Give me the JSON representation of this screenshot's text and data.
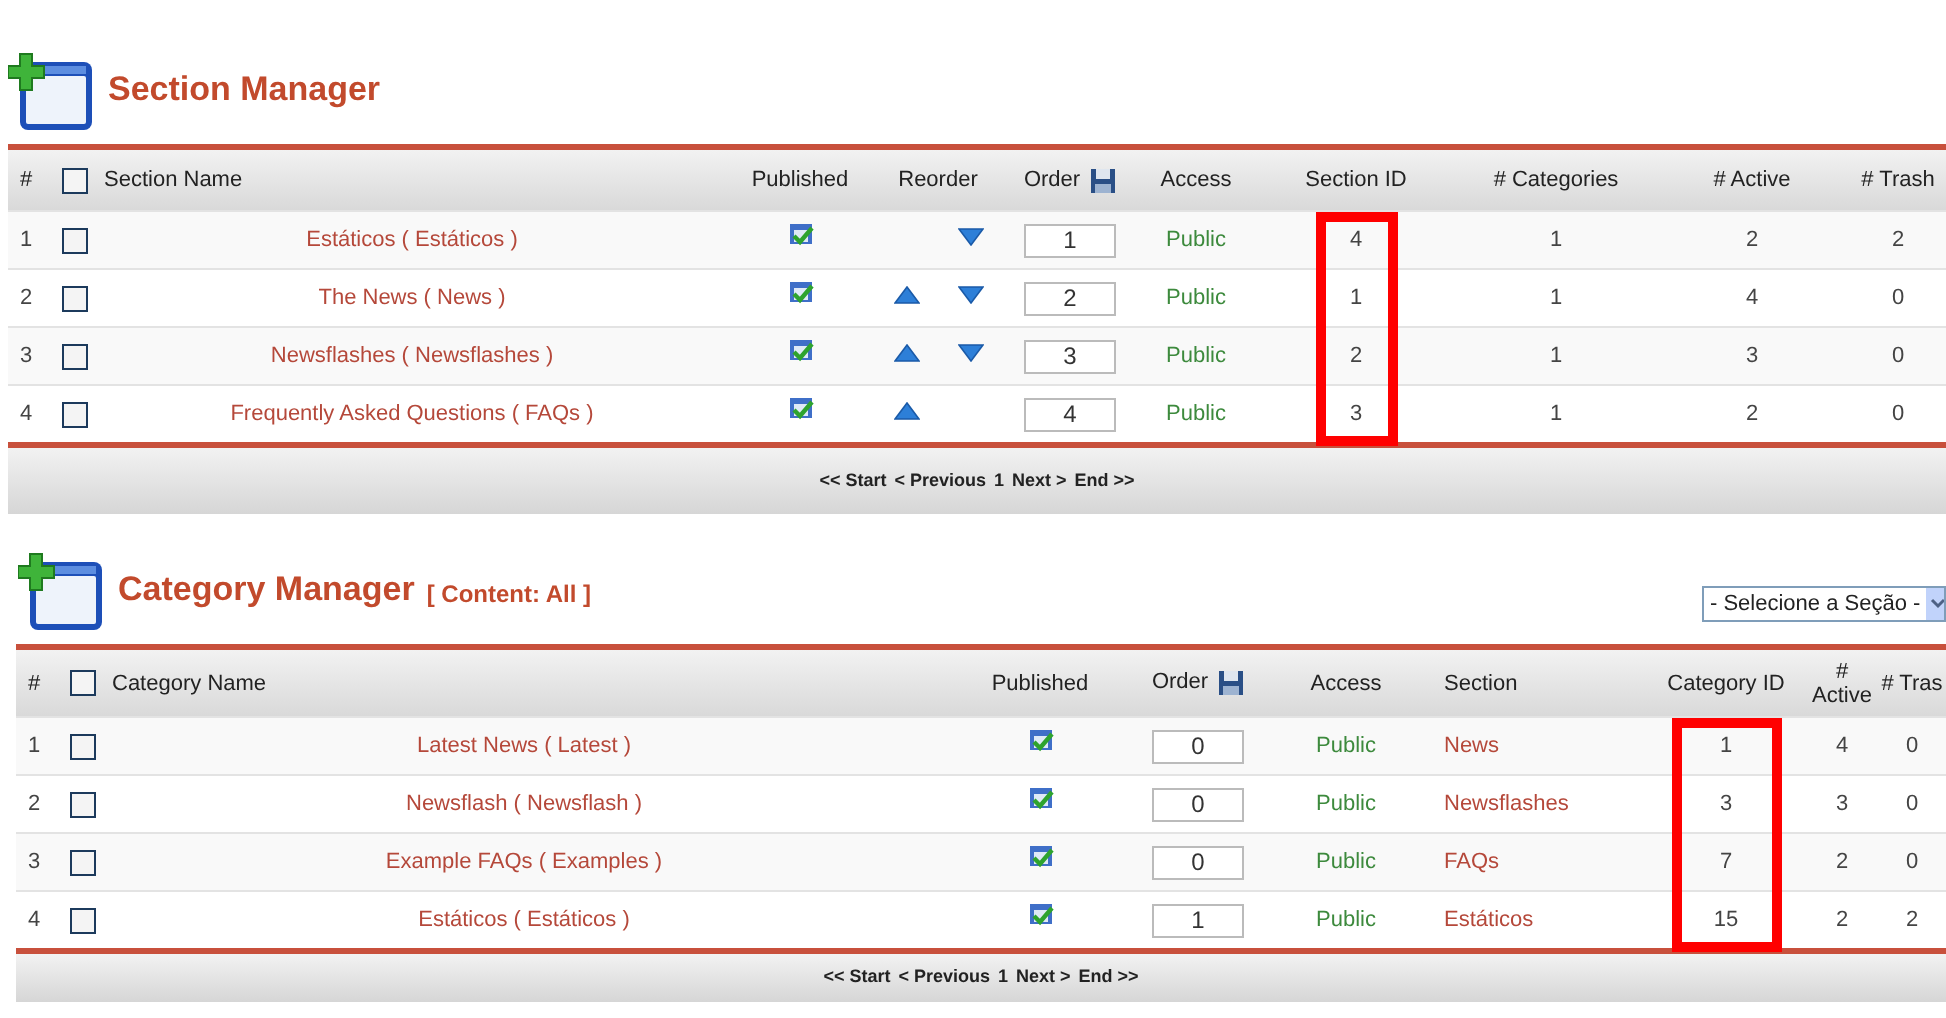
{
  "section_manager": {
    "title": "Section Manager",
    "table": {
      "columns": [
        {
          "kind": "number",
          "label": "#"
        },
        {
          "kind": "checkbox",
          "checked": false
        },
        {
          "kind": "name",
          "label": "Section Name"
        },
        {
          "kind": "published",
          "label": "Published"
        },
        {
          "kind": "reorder",
          "label": "Reorder"
        },
        {
          "kind": "order",
          "label": "Order"
        },
        {
          "kind": "access",
          "label": "Access"
        },
        {
          "kind": "text",
          "label": "Section ID",
          "highlighted": true
        },
        {
          "kind": "text",
          "label": "# Categories"
        },
        {
          "kind": "text",
          "label": "# Active"
        },
        {
          "kind": "text",
          "label": "# Trash"
        }
      ],
      "rows": [
        {
          "cells": [
            "1",
            {
              "checked": false
            },
            "Estáticos ( Estáticos )",
            {
              "published": true
            },
            {
              "up": false,
              "down": true
            },
            "1",
            "Public",
            "4",
            "1",
            "2",
            "2"
          ]
        },
        {
          "cells": [
            "2",
            {
              "checked": false
            },
            "The News ( News )",
            {
              "published": true
            },
            {
              "up": true,
              "down": true
            },
            "2",
            "Public",
            "1",
            "1",
            "4",
            "0"
          ]
        },
        {
          "cells": [
            "3",
            {
              "checked": false
            },
            "Newsflashes ( Newsflashes )",
            {
              "published": true
            },
            {
              "up": true,
              "down": true
            },
            "3",
            "Public",
            "2",
            "1",
            "3",
            "0"
          ]
        },
        {
          "cells": [
            "4",
            {
              "checked": false
            },
            "Frequently Asked Questions ( FAQs )",
            {
              "published": true
            },
            {
              "up": true,
              "down": false
            },
            "4",
            "Public",
            "3",
            "1",
            "2",
            "0"
          ]
        }
      ]
    },
    "pagination": [
      "<< Start",
      "< Previous",
      "1",
      "Next >",
      "End >>"
    ]
  },
  "category_manager": {
    "title": "Category Manager",
    "subtitle": "[ Content: All ]",
    "filter": {
      "value": "- Selecione a Seção -"
    },
    "table": {
      "columns": [
        {
          "kind": "number",
          "label": "#"
        },
        {
          "kind": "checkbox",
          "checked": false
        },
        {
          "kind": "name",
          "label": "Category Name"
        },
        {
          "kind": "published",
          "label": "Published"
        },
        {
          "kind": "order",
          "label": "Order"
        },
        {
          "kind": "access",
          "label": "Access"
        },
        {
          "kind": "section",
          "label": "Section"
        },
        {
          "kind": "text",
          "label": "Category ID",
          "highlighted": true
        },
        {
          "kind": "text",
          "label": "# Active"
        },
        {
          "kind": "text",
          "label": "# Tras"
        }
      ],
      "rows": [
        {
          "cells": [
            "1",
            {
              "checked": false
            },
            "Latest News ( Latest )",
            {
              "published": true
            },
            "0",
            "Public",
            "News",
            "1",
            "4",
            "0"
          ]
        },
        {
          "cells": [
            "2",
            {
              "checked": false
            },
            "Newsflash ( Newsflash )",
            {
              "published": true
            },
            "0",
            "Public",
            "Newsflashes",
            "3",
            "3",
            "0"
          ]
        },
        {
          "cells": [
            "3",
            {
              "checked": false
            },
            "Example FAQs ( Examples )",
            {
              "published": true
            },
            "0",
            "Public",
            "FAQs",
            "7",
            "2",
            "0"
          ]
        },
        {
          "cells": [
            "4",
            {
              "checked": false
            },
            "Estáticos ( Estáticos )",
            {
              "published": true
            },
            "1",
            "Public",
            "Estáticos",
            "15",
            "2",
            "2"
          ]
        }
      ]
    },
    "pagination": [
      "<< Start",
      "< Previous",
      "1",
      "Next >",
      "End >>"
    ]
  }
}
